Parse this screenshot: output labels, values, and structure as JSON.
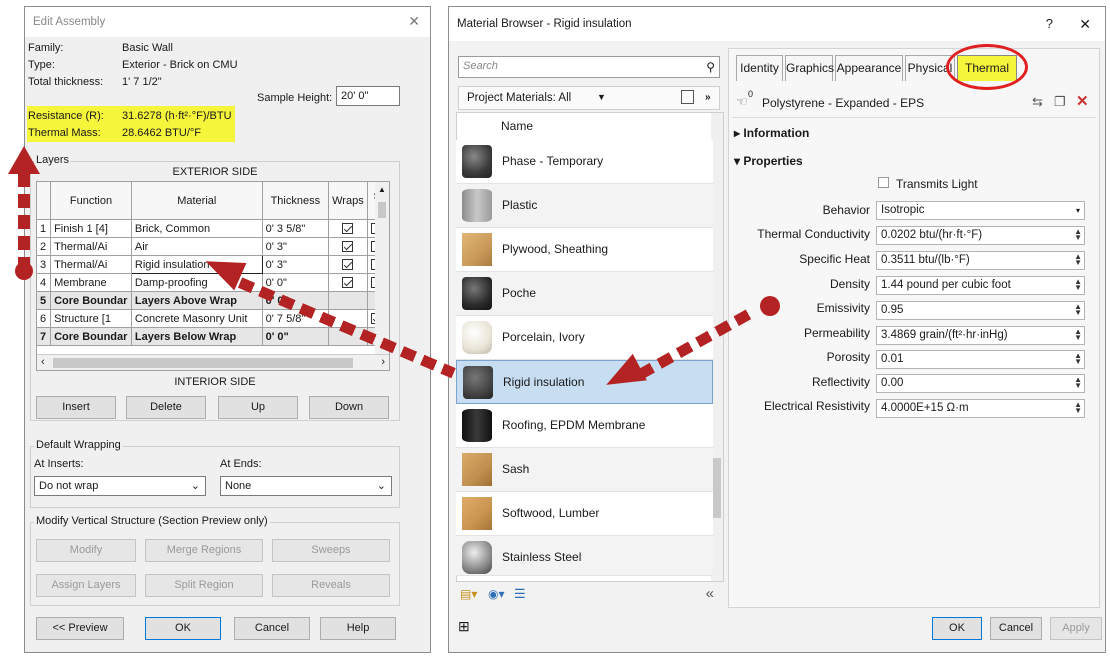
{
  "assembly": {
    "title": "Edit Assembly",
    "close_glyph": "✕",
    "family_label": "Family:",
    "family_value": "Basic Wall",
    "type_label": "Type:",
    "type_value": "Exterior - Brick on CMU",
    "thickness_label": "Total thickness:",
    "thickness_value": "1'  7 1/2\"",
    "resistance_label": "Resistance (R):",
    "resistance_value": "31.6278 (h·ft²·°F)/BTU",
    "mass_label": "Thermal Mass:",
    "mass_value": "28.6462 BTU/°F",
    "sample_label": "Sample Height:",
    "sample_value": "20'  0\"",
    "layers_label": "Layers",
    "exterior_label": "EXTERIOR SIDE",
    "interior_label": "INTERIOR SIDE",
    "columns": [
      "Function",
      "Material",
      "Thickness",
      "Wraps",
      "Str M"
    ],
    "rows": [
      {
        "num": "1",
        "function": "Finish 1 [4]",
        "material": "Brick, Common",
        "thickness": "0'  3 5/8\""
      },
      {
        "num": "2",
        "function": "Thermal/Ai",
        "material": "Air",
        "thickness": "0'  3\""
      },
      {
        "num": "3",
        "function": "Thermal/Ai",
        "material": "Rigid insulation",
        "thickness": "0'  3\""
      },
      {
        "num": "4",
        "function": "Membrane",
        "material": "Damp-proofing",
        "thickness": "0'  0\""
      },
      {
        "num": "5",
        "function": "Core Boundar",
        "material": "Layers Above Wrap",
        "thickness": "0'  0\""
      },
      {
        "num": "6",
        "function": "Structure [1",
        "material": "Concrete Masonry Unit",
        "thickness": "0'  7 5/8\""
      },
      {
        "num": "7",
        "function": "Core Boundar",
        "material": "Layers Below Wrap",
        "thickness": "0'  0\""
      }
    ],
    "buttons": {
      "insert": "Insert",
      "delete": "Delete",
      "up": "Up",
      "down": "Down"
    },
    "wrapping_label": "Default Wrapping",
    "at_inserts_label": "At Inserts:",
    "at_inserts_value": "Do not wrap",
    "at_ends_label": "At Ends:",
    "at_ends_value": "None",
    "modify_label": "Modify Vertical Structure (Section Preview only)",
    "modify_buttons": {
      "modify": "Modify",
      "merge": "Merge Regions",
      "sweeps": "Sweeps",
      "assign": "Assign Layers",
      "split": "Split Region",
      "reveals": "Reveals"
    },
    "footer": {
      "preview": "<< Preview",
      "ok": "OK",
      "cancel": "Cancel",
      "help": "Help"
    }
  },
  "browser": {
    "title": "Material Browser - Rigid insulation",
    "help_glyph": "?",
    "close_glyph": "✕",
    "search_placeholder": "Search",
    "filter_label": "Project Materials: All",
    "name_header": "Name",
    "materials": [
      {
        "name": "Phase - Temporary",
        "color": "#3a3a3a"
      },
      {
        "name": "Plastic",
        "color": "#a8a8a8"
      },
      {
        "name": "Plywood, Sheathing",
        "color": "#c99a5a"
      },
      {
        "name": "Poche",
        "color": "#2b2b2b"
      },
      {
        "name": "Porcelain, Ivory",
        "color": "#e9e4d6"
      },
      {
        "name": "Rigid insulation",
        "color": "#444444"
      },
      {
        "name": "Roofing, EPDM Membrane",
        "color": "#1f1f1f"
      },
      {
        "name": "Sash",
        "color": "#c18f4f"
      },
      {
        "name": "Softwood, Lumber",
        "color": "#c9944f"
      },
      {
        "name": "Stainless Steel",
        "color": "#8a8a8a"
      }
    ],
    "tabs": [
      "Identity",
      "Graphics",
      "Appearance",
      "Physical",
      "Thermal"
    ],
    "asset_count": "0",
    "asset_name": "Polystyrene - Expanded - EPS",
    "information_label": "Information",
    "properties_label": "Properties",
    "transmits_label": "Transmits Light",
    "properties": [
      {
        "label": "Behavior",
        "value": "Isotropic"
      },
      {
        "label": "Thermal Conductivity",
        "value": "0.0202 btu/(hr·ft·°F)"
      },
      {
        "label": "Specific Heat",
        "value": "0.3511 btu/(lb·°F)"
      },
      {
        "label": "Density",
        "value": "1.44 pound per cubic foot"
      },
      {
        "label": "Emissivity",
        "value": "0.95"
      },
      {
        "label": "Permeability",
        "value": "3.4869 grain/(ft²·hr·inHg)"
      },
      {
        "label": "Porosity",
        "value": "0.01"
      },
      {
        "label": "Reflectivity",
        "value": "0.00"
      },
      {
        "label": "Electrical Resistivity",
        "value": "4.0000E+15 Ω·m"
      }
    ],
    "footer": {
      "ok": "OK",
      "cancel": "Cancel",
      "apply": "Apply"
    }
  },
  "colors": {
    "highlight": "#f5f53c",
    "arrow": "#b42323",
    "selection": "#c7ddf2",
    "thermal_circle": "#e02020"
  }
}
